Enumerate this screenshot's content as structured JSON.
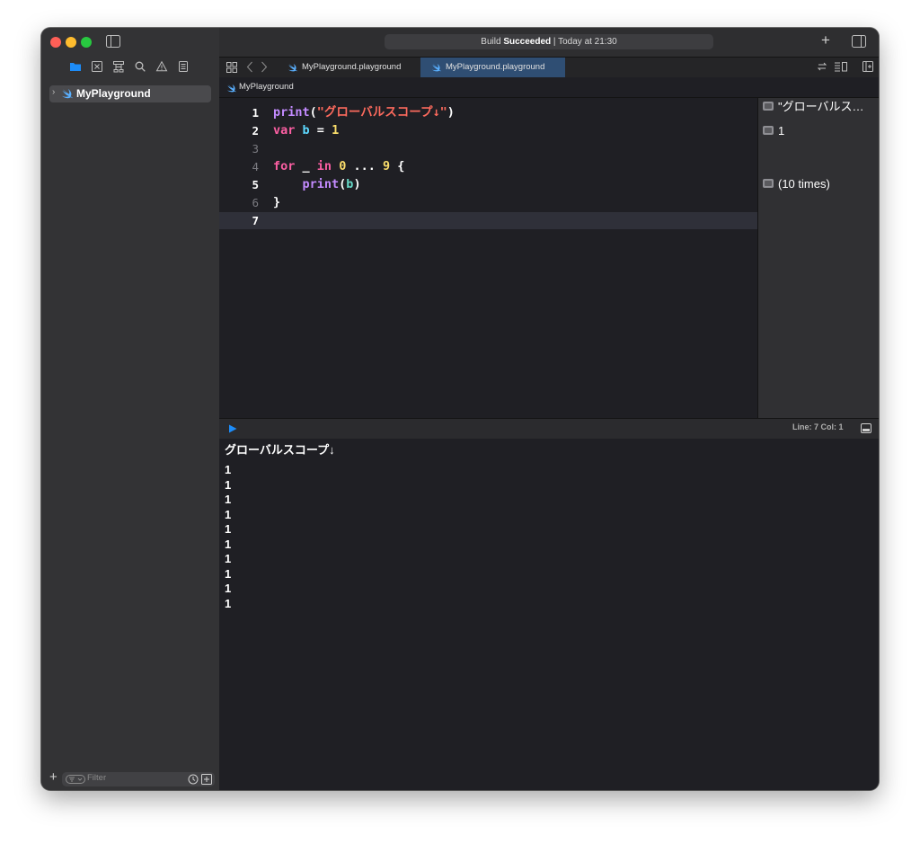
{
  "window": {
    "activity_build_label": "Build",
    "activity_status": "Succeeded",
    "activity_time": "| Today at 21:30"
  },
  "sidebar": {
    "navigator_tabs": [
      "folder-icon",
      "xmark-square-icon",
      "hierarchy-icon",
      "magnifier-icon",
      "warning-icon",
      "document-icon"
    ],
    "project_item_label": "MyPlayground",
    "filter_placeholder": "Filter"
  },
  "tabs": [
    {
      "label": "MyPlayground.playground",
      "active": false
    },
    {
      "label": "MyPlayground.playground",
      "active": true
    }
  ],
  "jumpbar": {
    "crumb": "MyPlayground"
  },
  "editor": {
    "line_numbers": [
      "1",
      "2",
      "3",
      "4",
      "5",
      "6",
      "7"
    ],
    "current_line": 7,
    "code": {
      "l1_fn": "print",
      "l1_open": "(",
      "l1_str": "\"グローバルスコープ↓\"",
      "l1_close": ")",
      "l2_kw": "var",
      "l2_id": "b",
      "l2_eq": " = ",
      "l2_num": "1",
      "l4_kw": "for",
      "l4_us": " _ ",
      "l4_in": "in",
      "l4_n0": "0",
      "l4_range": " ... ",
      "l4_n9": "9",
      "l4_brace": " {",
      "l5_fn": "print",
      "l5_open": "(",
      "l5_id": "b",
      "l5_close": ")",
      "l6_brace": "}"
    }
  },
  "results": [
    {
      "line": 1,
      "text": "\"グローバルス…"
    },
    {
      "line": 2,
      "text": "1"
    },
    {
      "line": 5,
      "text": "(10 times)"
    }
  ],
  "debug": {
    "cursor_position": "Line: 7  Col: 1"
  },
  "console": {
    "lines": [
      "グローバルスコープ↓",
      "1",
      "1",
      "1",
      "1",
      "1",
      "1",
      "1",
      "1",
      "1",
      "1"
    ]
  },
  "colors": {
    "keyword": "#fc5fa3",
    "function": "#c38bff",
    "string": "#fc6a5d",
    "number": "#fadd6b",
    "identifier": "#5dd8ff",
    "active_tab": "#2f4e73",
    "run_button": "#1d8cf8"
  }
}
